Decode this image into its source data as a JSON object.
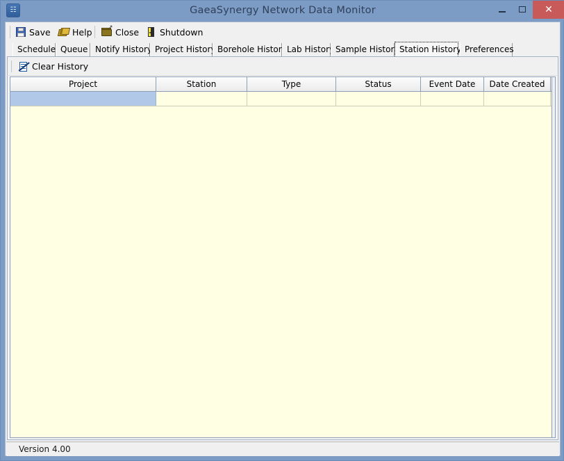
{
  "window": {
    "title": "GaeaSynergy Network Data Monitor",
    "app_icon": "network-monitor-icon",
    "controls": {
      "minimize": "minimize-button",
      "maximize": "maximize-button",
      "close": "close-button",
      "close_glyph": "✕"
    },
    "titlebar_color": "#7c9cc6",
    "close_button_color": "#c85a5a"
  },
  "toolbar": {
    "items": [
      {
        "label": "Save",
        "icon": "floppy-disk-icon"
      },
      {
        "label": "Help",
        "icon": "book-icon"
      },
      {
        "label": "Close",
        "icon": "open-folder-icon"
      },
      {
        "label": "Shutdown",
        "icon": "door-exit-icon"
      }
    ]
  },
  "tabs": {
    "items": [
      {
        "label": "Schedule",
        "selected": false
      },
      {
        "label": "Queue",
        "selected": false
      },
      {
        "label": "Notify History",
        "selected": false
      },
      {
        "label": "Project History",
        "selected": false
      },
      {
        "label": "Borehole History",
        "selected": false
      },
      {
        "label": "Lab History",
        "selected": false
      },
      {
        "label": "Sample History",
        "selected": false
      },
      {
        "label": "Station History",
        "selected": true
      },
      {
        "label": "Preferences",
        "selected": false
      }
    ],
    "selected_label": "Station History"
  },
  "subtoolbar": {
    "clear_history": {
      "label": "Clear History",
      "icon": "clear-history-icon"
    }
  },
  "grid": {
    "columns": [
      {
        "label": "Project"
      },
      {
        "label": "Station"
      },
      {
        "label": "Type"
      },
      {
        "label": "Status"
      },
      {
        "label": "Event Date"
      },
      {
        "label": "Date Created"
      }
    ],
    "rows": [
      {
        "cells": [
          "",
          "",
          "",
          "",
          "",
          ""
        ],
        "selected_cell": 0
      }
    ],
    "background_color": "#ffffe4",
    "selection_color": "#b2c8e8"
  },
  "statusbar": {
    "version": "Version 4.00"
  }
}
